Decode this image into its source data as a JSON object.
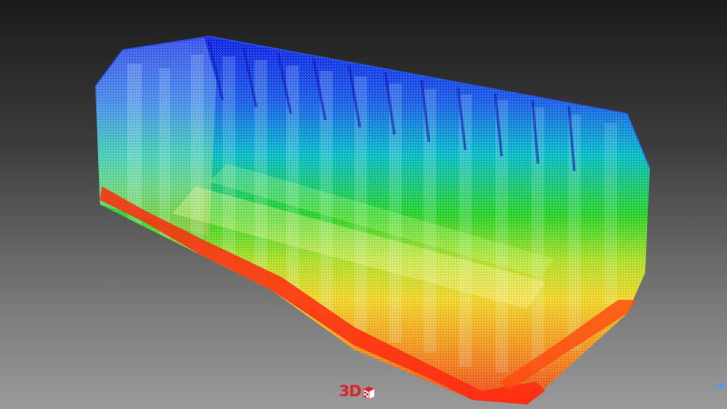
{
  "viewer": {
    "logo_text": "3D",
    "logo_mark_icon": "checkered-cube-icon",
    "corner_icon": "crosshair-icon"
  },
  "colors": {
    "background_top": "#1b1b1b",
    "background_bottom": "#9a9a9a",
    "scale_high": "#0a1cff",
    "scale_mid_high": "#00d2d2",
    "scale_mid": "#22e022",
    "scale_mid_low": "#f0e020",
    "scale_low": "#ff2a10",
    "logo_red": "#d8262c"
  }
}
